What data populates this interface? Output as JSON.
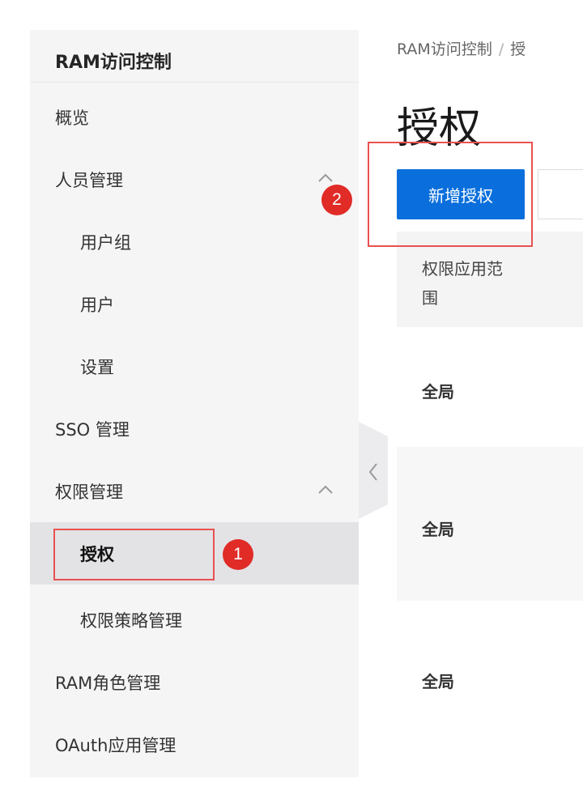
{
  "sidebar": {
    "title": "RAM访问控制",
    "items": [
      {
        "label": "概览"
      },
      {
        "label": "人员管理"
      },
      {
        "label": "用户组"
      },
      {
        "label": "用户"
      },
      {
        "label": "设置"
      },
      {
        "label": "SSO 管理"
      },
      {
        "label": "权限管理"
      },
      {
        "label": "授权"
      },
      {
        "label": "权限策略管理"
      },
      {
        "label": "RAM角色管理"
      },
      {
        "label": "OAuth应用管理"
      }
    ]
  },
  "breadcrumb": {
    "root": "RAM访问控制",
    "separator": "/",
    "current": "授"
  },
  "page": {
    "title": "授权",
    "add_button": "新增授权"
  },
  "table": {
    "header": "权限应用范围",
    "rows": [
      "全局",
      "全局",
      "全局"
    ]
  },
  "annotations": {
    "badge_1": "1",
    "badge_2": "2"
  },
  "colors": {
    "accent": "#0a6fdc",
    "highlight": "#e85150",
    "badge": "#e02b27"
  }
}
